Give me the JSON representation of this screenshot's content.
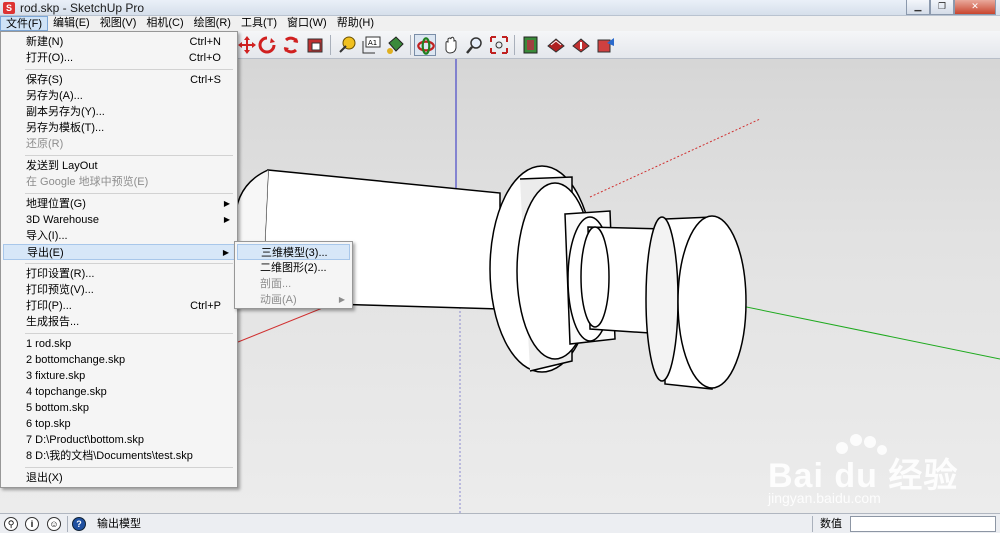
{
  "window": {
    "title": "rod.skp - SketchUp Pro",
    "app_icon_letter": "S"
  },
  "menubar": [
    "文件(F)",
    "编辑(E)",
    "视图(V)",
    "相机(C)",
    "绘图(R)",
    "工具(T)",
    "窗口(W)",
    "帮助(H)"
  ],
  "toolbar": {
    "icons": [
      "move-icon",
      "rotate-icon",
      "scale-icon",
      "tape-measure-icon",
      "dimension-icon",
      "paint-bucket-icon",
      "orbit-icon",
      "pan-icon",
      "zoom-icon",
      "zoom-extents-icon",
      "components-icon",
      "warehouse-icon",
      "share-model-icon",
      "extension-icon"
    ],
    "dimension_text": "A1"
  },
  "file_menu": {
    "items": [
      {
        "label": "新建(N)",
        "shortcut": "Ctrl+N"
      },
      {
        "label": "打开(O)...",
        "shortcut": "Ctrl+O"
      },
      {
        "label": "保存(S)",
        "shortcut": "Ctrl+S"
      },
      {
        "label": "另存为(A)...",
        "shortcut": ""
      },
      {
        "label": "副本另存为(Y)...",
        "shortcut": ""
      },
      {
        "label": "另存为模板(T)...",
        "shortcut": ""
      },
      {
        "label": "还原(R)",
        "shortcut": ""
      },
      {
        "label": "发送到 LayOut",
        "shortcut": ""
      },
      {
        "label": "在 Google 地球中预览(E)",
        "shortcut": ""
      },
      {
        "label": "地理位置(G)",
        "shortcut": ""
      },
      {
        "label": "3D Warehouse",
        "shortcut": ""
      },
      {
        "label": "导入(I)...",
        "shortcut": ""
      },
      {
        "label": "导出(E)",
        "shortcut": ""
      },
      {
        "label": "打印设置(R)...",
        "shortcut": ""
      },
      {
        "label": "打印预览(V)...",
        "shortcut": ""
      },
      {
        "label": "打印(P)...",
        "shortcut": "Ctrl+P"
      },
      {
        "label": "生成报告...",
        "shortcut": ""
      },
      {
        "label": "1 rod.skp",
        "shortcut": ""
      },
      {
        "label": "2 bottomchange.skp",
        "shortcut": ""
      },
      {
        "label": "3 fixture.skp",
        "shortcut": ""
      },
      {
        "label": "4 topchange.skp",
        "shortcut": ""
      },
      {
        "label": "5 bottom.skp",
        "shortcut": ""
      },
      {
        "label": "6 top.skp",
        "shortcut": ""
      },
      {
        "label": "7 D:\\Product\\bottom.skp",
        "shortcut": ""
      },
      {
        "label": "8 D:\\我的文档\\Documents\\test.skp",
        "shortcut": ""
      },
      {
        "label": "退出(X)",
        "shortcut": ""
      }
    ]
  },
  "export_submenu": {
    "items": [
      {
        "label": "三维模型(3)..."
      },
      {
        "label": "二维图形(2)..."
      },
      {
        "label": "剖面..."
      },
      {
        "label": "动画(A)"
      }
    ]
  },
  "statusbar": {
    "message": "输出模型",
    "measure_label": "数值",
    "measure_value": "",
    "icon_info": "i",
    "icon_help": "?"
  },
  "watermark": {
    "brand": "Bai du 经验",
    "url": "jingyan.baidu.com"
  },
  "colors": {
    "axis_red": "#d03030",
    "axis_green": "#1faa1f",
    "axis_blue": "#2b2bc4",
    "highlight": "#d7e7f8"
  }
}
